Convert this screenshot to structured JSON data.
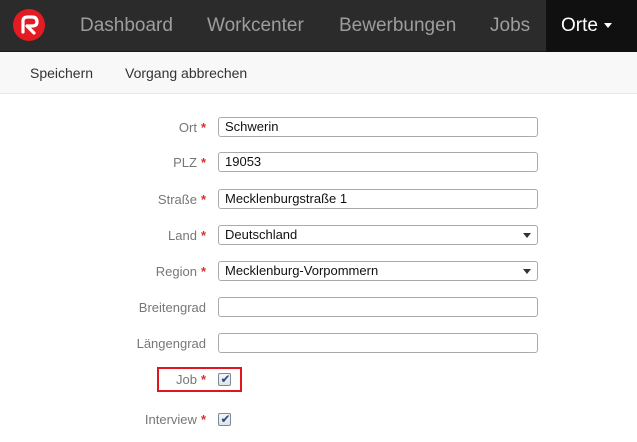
{
  "navbar": {
    "logo_icon": "brand-logo-icon",
    "brand_color": "#e31b23",
    "items": [
      {
        "label": "Dashboard"
      },
      {
        "label": "Workcenter"
      },
      {
        "label": "Bewerbungen"
      },
      {
        "label": "Jobs"
      },
      {
        "label": "Orte"
      }
    ],
    "active_index": 4
  },
  "toolbar": {
    "save_label": "Speichern",
    "cancel_label": "Vorgang abbrechen"
  },
  "form": {
    "ort": {
      "label": "Ort",
      "required": "*",
      "value": "Schwerin"
    },
    "plz": {
      "label": "PLZ",
      "required": "*",
      "value": "19053"
    },
    "strasse": {
      "label": "Straße",
      "required": "*",
      "value": "Mecklenburgstraße 1"
    },
    "land": {
      "label": "Land",
      "required": "*",
      "value": "Deutschland"
    },
    "region": {
      "label": "Region",
      "required": "*",
      "value": "Mecklenburg-Vorpommern"
    },
    "breitengrad": {
      "label": "Breitengrad",
      "value": ""
    },
    "laengengrad": {
      "label": "Längengrad",
      "value": ""
    },
    "job": {
      "label": "Job",
      "required": "*",
      "checked": true
    },
    "interview": {
      "label": "Interview",
      "required": "*",
      "checked": true
    }
  },
  "colors": {
    "required_marker": "#d9302c",
    "highlight": "#e0151f"
  }
}
